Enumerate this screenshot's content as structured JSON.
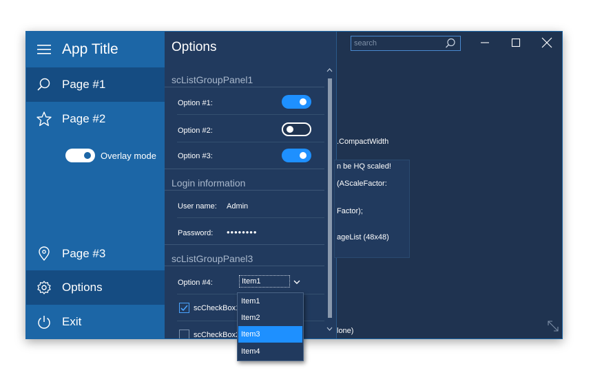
{
  "sidebar": {
    "app_title": "App Title",
    "items": [
      {
        "label": "Page #1",
        "icon": "search-icon"
      },
      {
        "label": "Page #2",
        "icon": "star-icon"
      },
      {
        "label": "Page #3",
        "icon": "map-pin-icon"
      },
      {
        "label": "Options",
        "icon": "gear-icon"
      },
      {
        "label": "Exit",
        "icon": "power-icon"
      }
    ],
    "overlay_mode_label": "Overlay mode",
    "overlay_mode_on": true
  },
  "options": {
    "title": "Options",
    "group1": {
      "header": "scListGroupPanel1",
      "rows": [
        {
          "label": "Option #1:",
          "on": true
        },
        {
          "label": "Option #2:",
          "on": false
        },
        {
          "label": "Option #3:",
          "on": true
        }
      ]
    },
    "group2": {
      "header": "Login information",
      "user_label": "User name:",
      "user_value": "Admin",
      "password_label": "Password:",
      "password_value": "••••••••"
    },
    "group3": {
      "header": "scListGroupPanel3",
      "option4_label": "Option #4:",
      "option4_value": "Item1",
      "checkbox1_label": "scCheckBox1",
      "checkbox1_checked": true,
      "checkbox2_label": "scCheckBox2",
      "checkbox2_checked": false
    }
  },
  "dropdown": {
    "items": [
      "Item1",
      "Item2",
      "Item3",
      "Item4"
    ],
    "selected": "Item3"
  },
  "main": {
    "search_placeholder": "search",
    "snippets": [
      ".CompactWidth",
      "n be HQ scaled!",
      "(AScaleFactor:",
      "Factor);",
      "ageList (48x48)",
      "lone)"
    ]
  },
  "colors": {
    "sidebar": "#1c66a6",
    "sidebar_active": "#154c82",
    "panel": "#213a5e",
    "window": "#1f3350",
    "accent": "#1e90ff"
  }
}
